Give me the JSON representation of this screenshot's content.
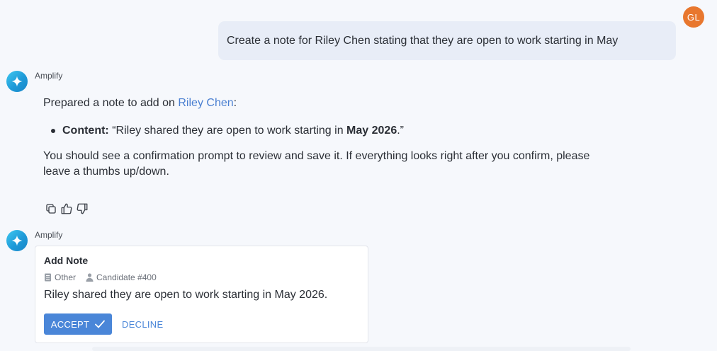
{
  "user": {
    "initials": "GL",
    "message": "Create a note for Riley Chen stating that they are open to work starting in May"
  },
  "assistant": {
    "name": "Amplify",
    "intro_prefix": "Prepared a note to add on ",
    "intro_link": "Riley Chen",
    "intro_suffix": ":",
    "bullet_label": "Content:",
    "bullet_prefix": " “Riley shared they are open to work starting in ",
    "bullet_bold": "May 2026",
    "bullet_suffix": ".”",
    "line1": "You should see a confirmation prompt to review and save it. If everything looks right after you confirm, please",
    "line2": "leave a thumbs up/down."
  },
  "action_icons": [
    "copy-icon",
    "thumbs-up-icon",
    "thumbs-down-icon"
  ],
  "card": {
    "agent_name": "Amplify",
    "title": "Add Note",
    "category": "Other",
    "candidate": "Candidate #400",
    "body": "Riley shared they are open to work starting in May 2026.",
    "accept_label": "ACCEPT",
    "decline_label": "DECLINE"
  },
  "colors": {
    "accent": "#4a86d8",
    "link": "#4a7fd1",
    "user_avatar": "#e8772e",
    "bubble": "#e8edf7"
  }
}
